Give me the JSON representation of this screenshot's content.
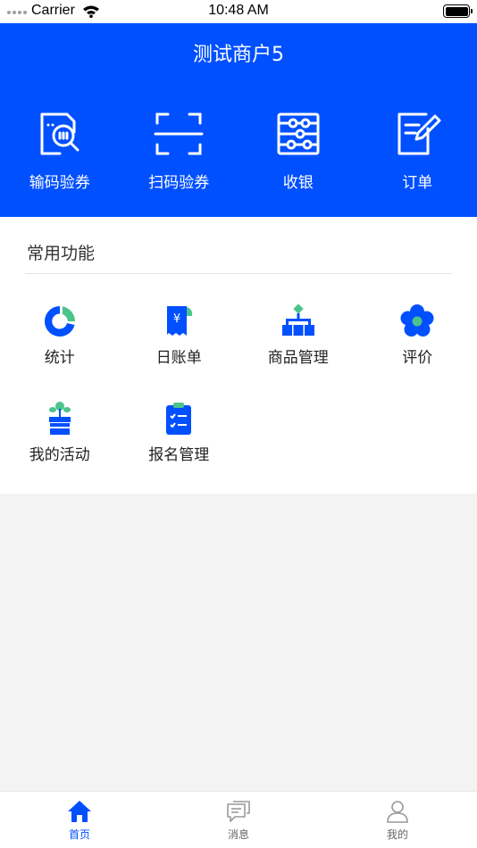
{
  "status_bar": {
    "carrier": "Carrier",
    "time": "10:48 AM"
  },
  "header": {
    "title": "测试商户5",
    "actions": [
      {
        "label": "输码验券",
        "icon": "code-verify-icon"
      },
      {
        "label": "扫码验券",
        "icon": "scan-verify-icon"
      },
      {
        "label": "收银",
        "icon": "abacus-icon"
      },
      {
        "label": "订单",
        "icon": "order-edit-icon"
      }
    ]
  },
  "common": {
    "title": "常用功能",
    "items": [
      {
        "label": "统计",
        "icon": "pie-chart-icon"
      },
      {
        "label": "日账单",
        "icon": "daily-bill-icon"
      },
      {
        "label": "商品管理",
        "icon": "product-hierarchy-icon"
      },
      {
        "label": "评价",
        "icon": "review-flower-icon"
      },
      {
        "label": "我的活动",
        "icon": "activity-gift-icon"
      },
      {
        "label": "报名管理",
        "icon": "registration-clipboard-icon"
      }
    ]
  },
  "tabbar": {
    "tabs": [
      {
        "label": "首页",
        "icon": "home-icon",
        "active": true
      },
      {
        "label": "消息",
        "icon": "message-icon",
        "active": false
      },
      {
        "label": "我的",
        "icon": "profile-icon",
        "active": false
      }
    ]
  },
  "colors": {
    "primary": "#0050ff",
    "accent_green": "#4cc38a",
    "page_bg": "#f3f3f3"
  }
}
